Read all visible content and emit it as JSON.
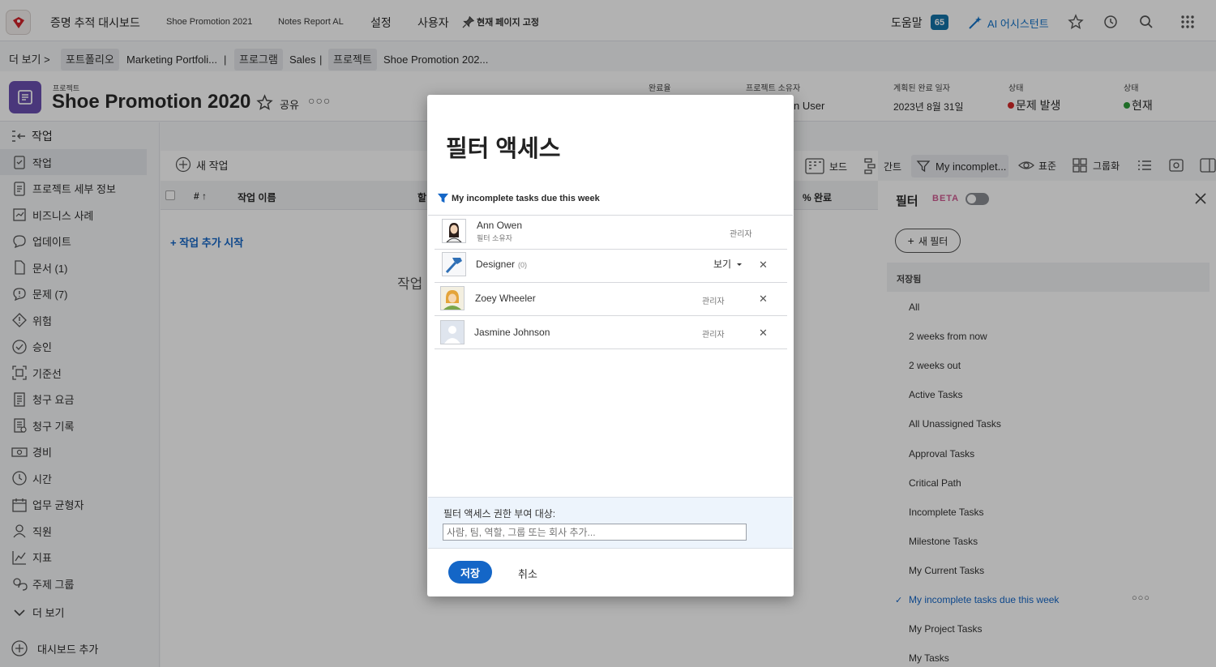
{
  "topbar": {
    "dashboard": "증명 추적 대시보드",
    "tab1": "Shoe Promotion 2021",
    "tab2": "Notes Report AL",
    "settings": "설정",
    "users": "사용자",
    "pin": "현재 페이지 고정",
    "help": "도움말",
    "help_count": "65",
    "ai": "AI 어시스턴트"
  },
  "breadcrumb": {
    "more": "더 보기",
    "portfolio_tag": "포트폴리오",
    "portfolio": "Marketing Portfoli...",
    "program_tag": "프로그램",
    "program": "Sales",
    "project_tag": "프로젝트",
    "project": "Shoe Promotion 202..."
  },
  "project": {
    "type": "프로젝트",
    "title": "Shoe Promotion 2020",
    "share": "공유",
    "completion_label": "완료율",
    "owner_label": "프로젝트 소유자",
    "owner_value": "n User",
    "planned_label": "계획된 완료 일자",
    "planned_value": "2023년 8월 31일",
    "status_label": "상태",
    "status_value": "문제 발생",
    "status2_label": "상태",
    "status2_value": "현재"
  },
  "sidebar": {
    "header": "작업",
    "items": [
      {
        "label": "작업",
        "icon": "task-icon"
      },
      {
        "label": "프로젝트 세부 정보",
        "icon": "document-icon"
      },
      {
        "label": "비즈니스 사례",
        "icon": "business-case-icon"
      },
      {
        "label": "업데이트",
        "icon": "chat-icon"
      },
      {
        "label": "문서 (1)",
        "icon": "file-icon"
      },
      {
        "label": "문제 (7)",
        "icon": "issue-icon"
      },
      {
        "label": "위험",
        "icon": "risk-icon"
      },
      {
        "label": "승인",
        "icon": "approval-icon"
      },
      {
        "label": "기준선",
        "icon": "baseline-icon"
      },
      {
        "label": "청구 요금",
        "icon": "billing-icon"
      },
      {
        "label": "청구 기록",
        "icon": "billing-record-icon"
      },
      {
        "label": "경비",
        "icon": "expense-icon"
      },
      {
        "label": "시간",
        "icon": "clock-icon"
      },
      {
        "label": "업무 균형자",
        "icon": "calendar-icon"
      },
      {
        "label": "직원",
        "icon": "person-icon"
      },
      {
        "label": "지표",
        "icon": "chart-icon"
      },
      {
        "label": "주제 그룹",
        "icon": "topic-icon"
      }
    ],
    "more": "더 보기",
    "add_dashboard": "대시보드 추가"
  },
  "main": {
    "new_task": "새 작업",
    "col_num": "#",
    "col_name": "작업 이름",
    "col_assign": "할",
    "col_percent": "% 완료",
    "add_task": "+ 작업 추가 시작",
    "empty": "작업",
    "board": "보드",
    "gantt": "간트",
    "filter_btn": "My incomplet...",
    "view": "표준",
    "group": "그룹화"
  },
  "filter_panel": {
    "title": "필터",
    "beta": "BETA",
    "new_filter": "새 필터",
    "saved": "저장됨",
    "items": [
      {
        "label": "All"
      },
      {
        "label": "2 weeks from now"
      },
      {
        "label": "2 weeks out"
      },
      {
        "label": "Active Tasks"
      },
      {
        "label": "All Unassigned Tasks"
      },
      {
        "label": "Approval Tasks"
      },
      {
        "label": "Critical Path"
      },
      {
        "label": "Incomplete Tasks"
      },
      {
        "label": "Milestone Tasks"
      },
      {
        "label": "My Current Tasks"
      },
      {
        "label": "My incomplete tasks due this week"
      },
      {
        "label": "My Project Tasks"
      },
      {
        "label": "My Tasks"
      }
    ]
  },
  "modal": {
    "title": "필터 액세스",
    "filter_name": "My incomplete tasks due this week",
    "rows": [
      {
        "name": "Ann Owen",
        "sub": "필터 소유자",
        "role": "관리자"
      },
      {
        "name": "Designer",
        "count": "(0)",
        "role": "보기"
      },
      {
        "name": "Zoey Wheeler",
        "role": "관리자"
      },
      {
        "name": "Jasmine Johnson",
        "role": "관리자"
      }
    ],
    "grant_label": "필터 액세스 권한 부여 대상:",
    "grant_placeholder": "사람, 팀, 역할, 그룹 또는 회사 추가...",
    "save": "저장",
    "cancel": "취소"
  },
  "colors": {
    "accent": "#1466c7",
    "project_icon": "#6b4fb0",
    "status_red": "#d42a2a",
    "status_green": "#2d9d3a"
  }
}
